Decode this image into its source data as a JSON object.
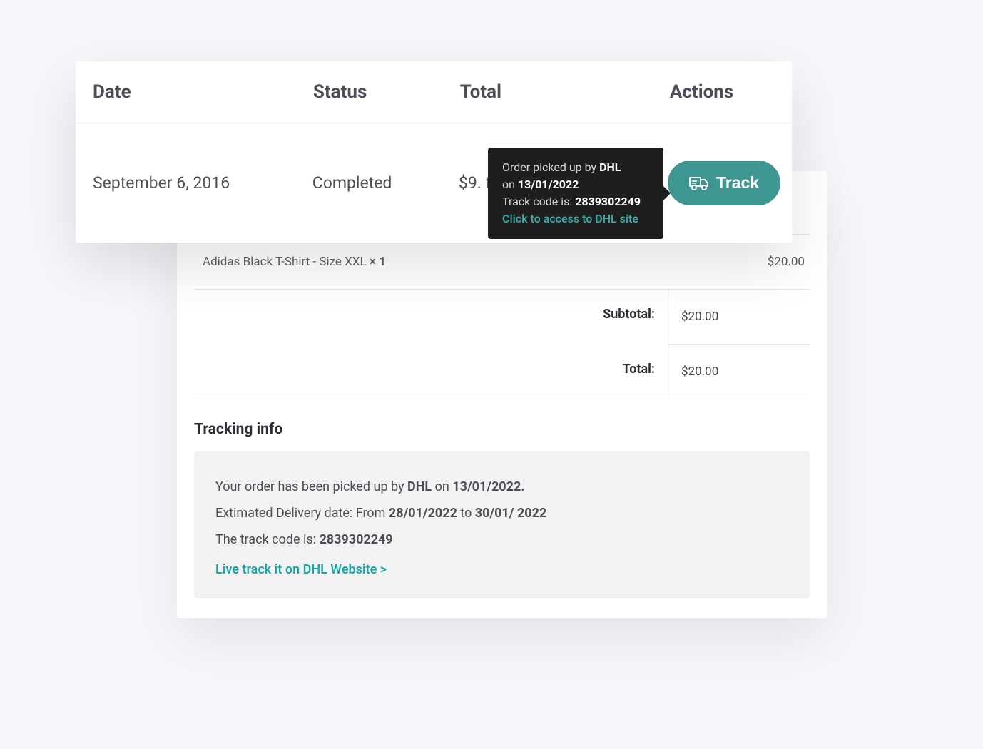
{
  "orders_table": {
    "headers": {
      "date": "Date",
      "status": "Status",
      "total": "Total",
      "actions": "Actions"
    },
    "row": {
      "date": "September 6, 2016",
      "status": "Completed",
      "total": "$9. f",
      "track_label": "Track"
    }
  },
  "tooltip": {
    "line1_prefix": "Order picked up by ",
    "carrier": "DHL",
    "line2_prefix": "on ",
    "date": "13/01/2022",
    "line3_prefix": "Track code is: ",
    "code": "2839302249",
    "link": "Click to access to DHL site"
  },
  "detail": {
    "product": {
      "name": "Adidas Black T-Shirt - Size XXL ",
      "qty": "× 1",
      "price": "$20.00"
    },
    "totals": {
      "subtotal_label": "Subtotal:",
      "subtotal_value": "$20.00",
      "total_label": "Total:",
      "total_value": "$20.00"
    },
    "tracking": {
      "heading": "Tracking info",
      "line1_a": "Your order has been picked up by ",
      "line1_b": "DHL",
      "line1_c": " on ",
      "line1_d": "13/01/2022.",
      "line2_a": "Extimated Delivery date: From ",
      "line2_b": "28/01/2022",
      "line2_c": " to ",
      "line2_d": "30/01/ 2022",
      "line3_a": "The track code is: ",
      "line3_b": "2839302249",
      "link": "Live track it on DHL Website >"
    }
  }
}
